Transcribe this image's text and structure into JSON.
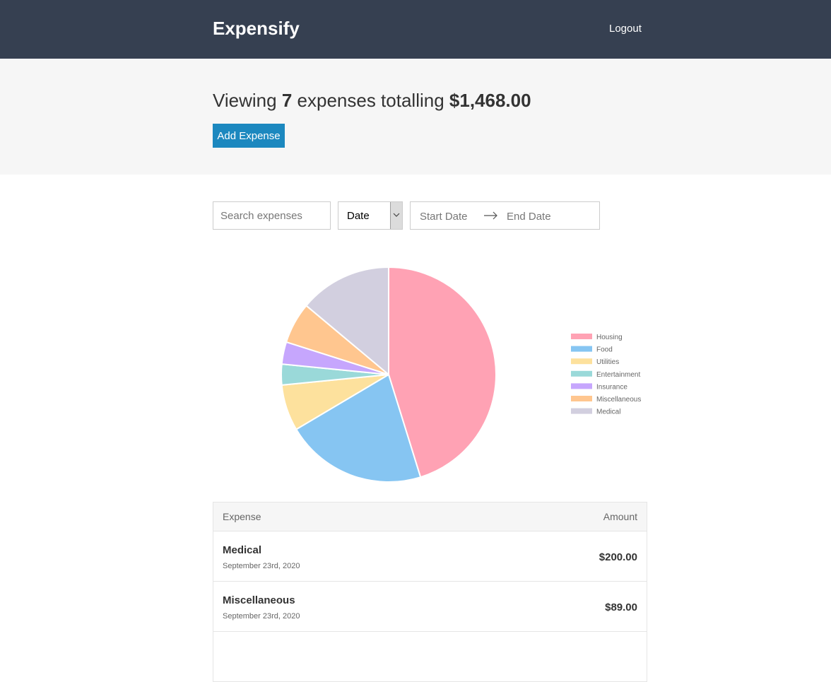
{
  "header": {
    "brand": "Expensify",
    "logout_label": "Logout"
  },
  "summary": {
    "prefix": "Viewing",
    "count": "7",
    "middle": "expenses totalling",
    "total": "$1,468.00",
    "add_label": "Add Expense"
  },
  "filters": {
    "search_placeholder": "Search expenses",
    "sort_value": "Date",
    "start_date_placeholder": "Start Date",
    "end_date_placeholder": "End Date"
  },
  "chart_data": {
    "type": "pie",
    "categories": [
      "Housing",
      "Food",
      "Utilities",
      "Entertainment",
      "Insurance",
      "Miscellaneous",
      "Medical"
    ],
    "values": [
      650,
      306,
      100,
      45,
      48,
      89,
      200
    ],
    "colors": [
      "#ffa2b4",
      "#86c5f2",
      "#fde19d",
      "#9ad9d9",
      "#c6a6fd",
      "#ffc68f",
      "#d2cfdf"
    ],
    "legend_position": "right"
  },
  "table": {
    "headers": {
      "expense": "Expense",
      "amount": "Amount"
    },
    "rows": [
      {
        "description": "Medical",
        "date": "September 23rd, 2020",
        "amount": "$200.00"
      },
      {
        "description": "Miscellaneous",
        "date": "September 23rd, 2020",
        "amount": "$89.00"
      }
    ]
  }
}
